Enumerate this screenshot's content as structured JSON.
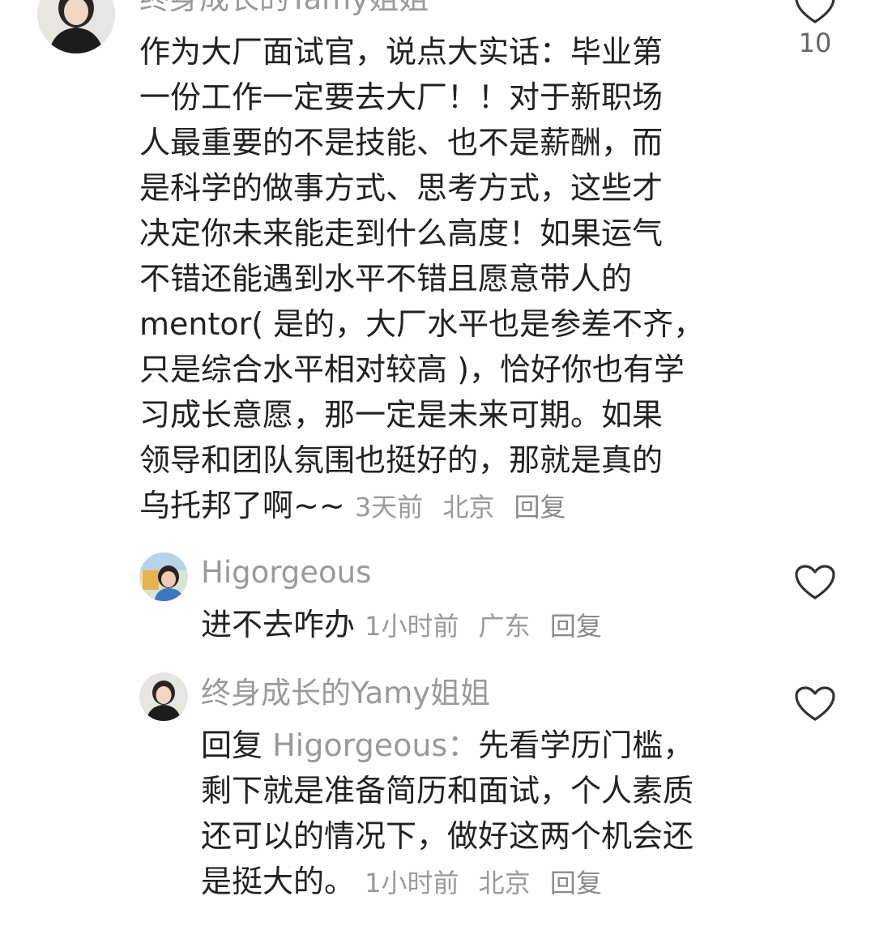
{
  "main_comment": {
    "username": "终身成长的Yamy姐姐",
    "lines": [
      "作为大厂面试官，说点大实话：毕业第",
      "一份工作一定要去大厂！！对于新职场",
      "人最重要的不是技能、也不是薪酬，而",
      "是科学的做事方式、思考方式，这些才",
      "决定你未来能走到什么高度！如果运气",
      "不错还能遇到水平不错且愿意带人的",
      "mentor( 是的，大厂水平也是参差不齐，",
      "只是综合水平相对较高 )，恰好你也有学",
      "习成长意愿，那一定是未来可期。如果",
      "领导和团队氛围也挺好的，那就是真的"
    ],
    "last_line": "乌托邦了啊~~",
    "time": "3天前",
    "location": "北京",
    "reply_label": "回复",
    "like_count": "10",
    "icon": "heart-outline-icon"
  },
  "replies": [
    {
      "username": "Higorgeous",
      "text": "进不去咋办",
      "time": "1小时前",
      "location": "广东",
      "reply_label": "回复",
      "icon": "heart-outline-icon"
    },
    {
      "username": "终身成长的Yamy姐姐",
      "reply_prefix": "回复",
      "reply_to": "Higorgeous：",
      "first_line": "先看学历门槛，",
      "lines": [
        "剩下就是准备简历和面试，个人素质",
        "还可以的情况下，做好这两个机会还"
      ],
      "last_line": "是挺大的。",
      "time": "1小时前",
      "location": "北京",
      "reply_label": "回复",
      "icon": "heart-outline-icon"
    }
  ],
  "colors": {
    "text": "#222222",
    "meta": "#9a9a9a",
    "icon_stroke": "#333333"
  }
}
